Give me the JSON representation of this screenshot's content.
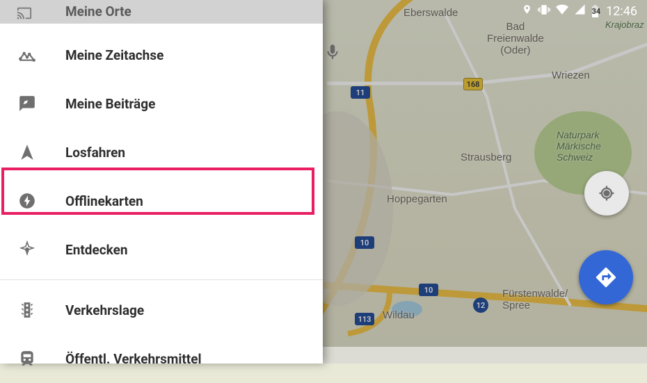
{
  "status": {
    "time": "12:46",
    "battery": "34"
  },
  "drawer": {
    "header_title": "Meine Orte",
    "items": [
      {
        "icon": "timeline",
        "label": "Meine Zeitachse"
      },
      {
        "icon": "review",
        "label": "Meine Beiträge"
      },
      {
        "icon": "arrow",
        "label": "Losfahren"
      },
      {
        "icon": "bolt",
        "label": "Offlinekarten"
      },
      {
        "icon": "compass",
        "label": "Entdecken"
      },
      {
        "icon": "traffic",
        "label": "Verkehrslage"
      },
      {
        "icon": "transit",
        "label": "Öffentl. Verkehrsmittel"
      }
    ],
    "highlighted_index": 3
  },
  "map": {
    "places": {
      "eberswalde": "Eberswalde",
      "bad_freienwalde": "Bad\nFreienwalde\n(Oder)",
      "wriezen": "Wriezen",
      "strausberg": "Strausberg",
      "hoppegarten": "Hoppegarten",
      "wildau": "Wildau",
      "furstenwalde": "Fürstenwalde/\nSpree",
      "krajobraz": "Krajobraz",
      "naturpark": "Naturpark\nMärkische\nSchweiz"
    },
    "roads": {
      "a11": "11",
      "b168": "168",
      "a10a": "10",
      "a10b": "10",
      "a113": "113",
      "a12": "12"
    }
  }
}
